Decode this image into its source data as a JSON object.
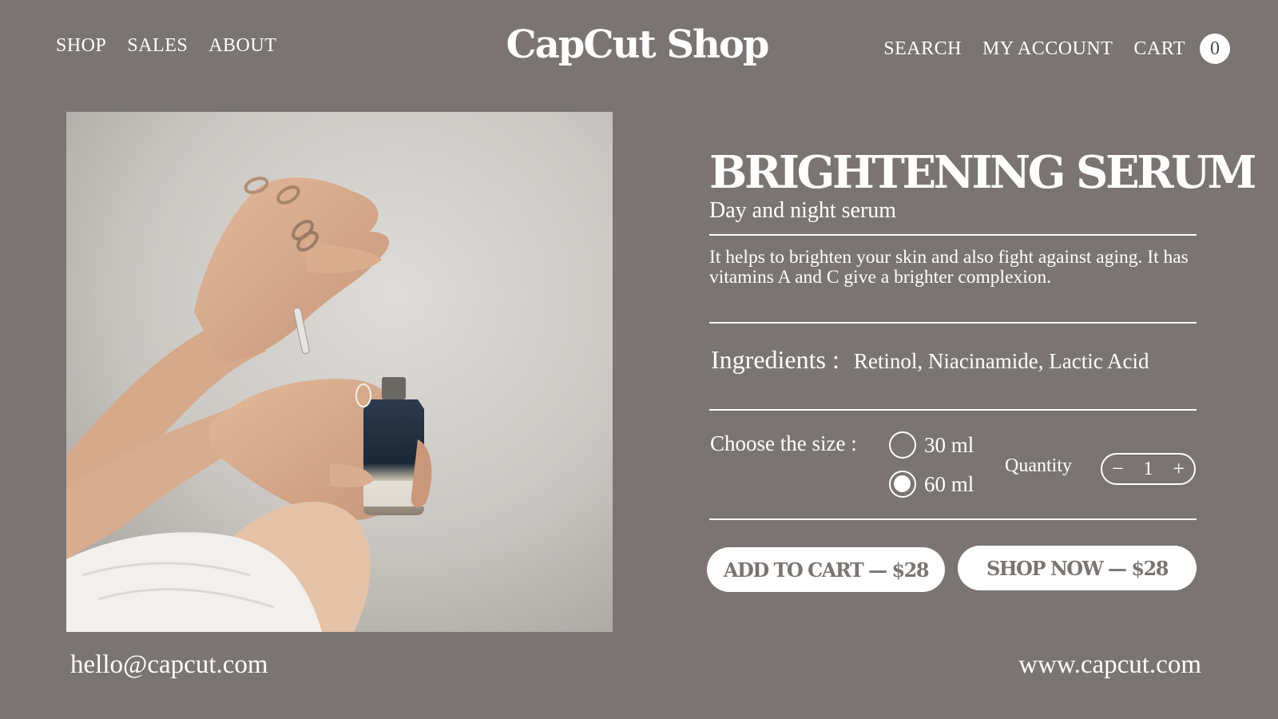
{
  "header": {
    "logo": "CapCut Shop",
    "nav_left": [
      "SHOP",
      "SALES",
      "ABOUT"
    ],
    "nav_right": {
      "search": "SEARCH",
      "account": "MY ACCOUNT",
      "cart": "CART",
      "cart_count": "0"
    }
  },
  "product": {
    "image_icon": "serum-dropper-photo",
    "title": "BRIGHTENING SERUM",
    "subtitle": "Day and night serum",
    "description": "It helps to brighten your skin and also fight against aging. It has vitamins A and C give a brighter complexion.",
    "ingredients_label": "Ingredients :",
    "ingredients_value": "Retinol, Niacinamide, Lactic Acid",
    "size_label": "Choose the size :",
    "sizes": [
      {
        "label": "30 ml",
        "selected": false
      },
      {
        "label": "60 ml",
        "selected": true
      }
    ],
    "quantity_label": "Quantity",
    "quantity": {
      "minus": "−",
      "value": "1",
      "plus": "+"
    }
  },
  "actions": {
    "add_to_cart": "ADD TO CART  — $28",
    "shop_now": "SHOP NOW — $28"
  },
  "footer": {
    "email": "hello@capcut.com",
    "website": "www.capcut.com"
  },
  "colors": {
    "background": "#7a7572",
    "text": "#ffffff",
    "button_bg": "#ffffff",
    "button_text": "#7a7572"
  }
}
